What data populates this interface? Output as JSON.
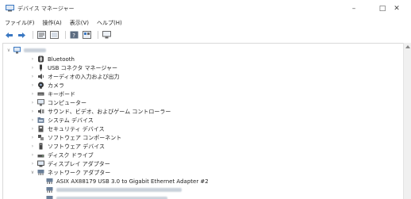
{
  "window": {
    "title": "デバイス マネージャー",
    "controls": {
      "minimize": "–",
      "maximize": "□",
      "close": "✕"
    }
  },
  "menu": {
    "items": [
      "ファイル(F)",
      "操作(A)",
      "表示(V)",
      "ヘルプ(H)"
    ]
  },
  "toolbar": {
    "buttons": [
      "back-icon",
      "forward-icon",
      "properties-icon",
      "device-list-icon",
      "help-icon",
      "view-icon",
      "monitor-icon"
    ]
  },
  "tree": {
    "root": {
      "icon": "computer-icon",
      "expanded": true
    },
    "categories": [
      {
        "label": "Bluetooth",
        "icon": "bluetooth-icon"
      },
      {
        "label": "USB コネクタ マネージャー",
        "icon": "usb-icon"
      },
      {
        "label": "オーディオの入力および出力",
        "icon": "speaker-icon"
      },
      {
        "label": "カメラ",
        "icon": "camera-icon"
      },
      {
        "label": "キーボード",
        "icon": "keyboard-icon"
      },
      {
        "label": "コンピューター",
        "icon": "computer-icon"
      },
      {
        "label": "サウンド、ビデオ、およびゲーム コントローラー",
        "icon": "sound-icon"
      },
      {
        "label": "システム デバイス",
        "icon": "system-folder-icon"
      },
      {
        "label": "セキュリティ デバイス",
        "icon": "security-icon"
      },
      {
        "label": "ソフトウェア コンポーネント",
        "icon": "component-icon"
      },
      {
        "label": "ソフトウェア デバイス",
        "icon": "software-device-icon"
      },
      {
        "label": "ディスク ドライブ",
        "icon": "disk-icon"
      },
      {
        "label": "ディスプレイ アダプター",
        "icon": "display-icon"
      },
      {
        "label": "ネットワーク アダプター",
        "icon": "network-icon",
        "expanded": true
      }
    ],
    "network_children": [
      {
        "label": "ASIX AX88179 USB 3.0 to Gigabit Ethernet Adapter #2",
        "icon": "network-card-icon"
      }
    ]
  },
  "colors": {
    "accent": "#3a78c2",
    "icon_gray": "#6b6b6b",
    "border": "#d9d9d9"
  }
}
